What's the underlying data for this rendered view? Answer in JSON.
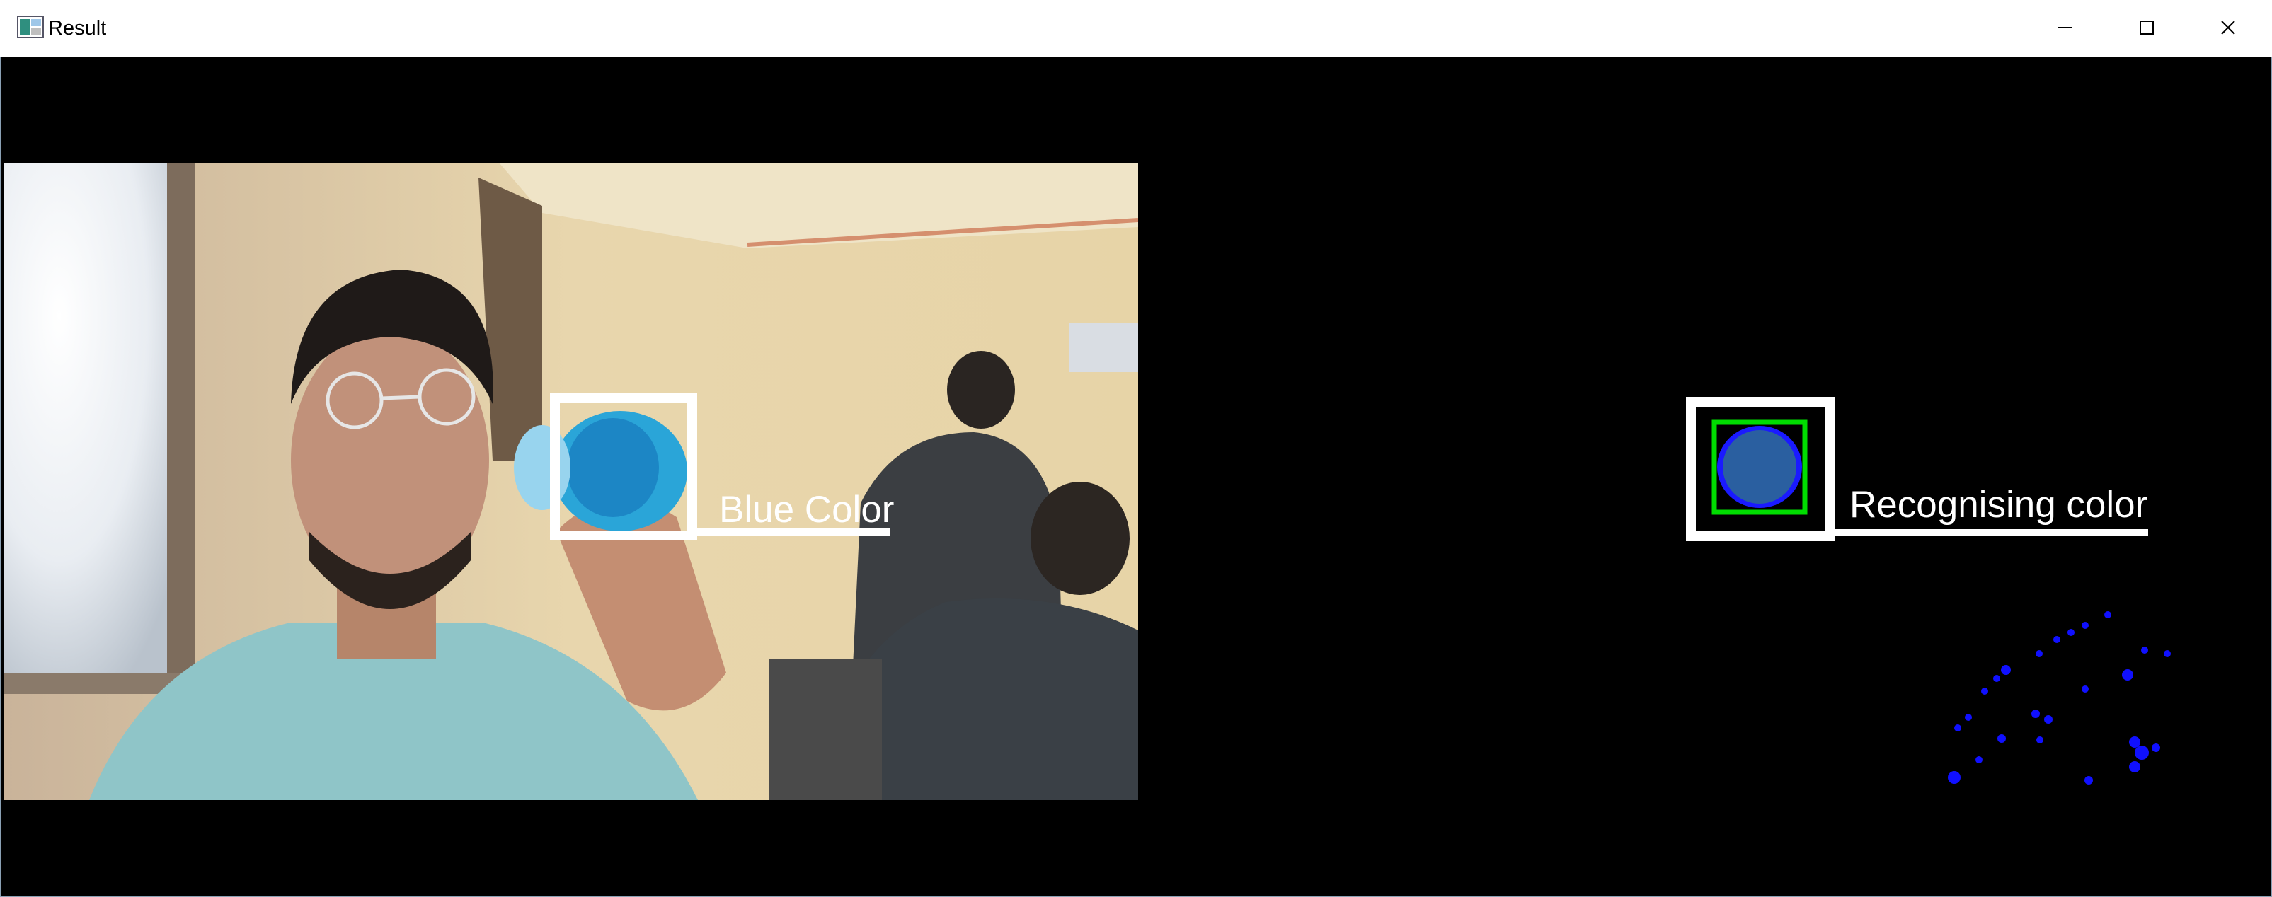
{
  "window": {
    "title": "Result",
    "icon": "opencv-window-icon",
    "controls": [
      "minimize-icon",
      "maximize-icon",
      "close-icon"
    ]
  },
  "left_frame": {
    "detected_label": "Blue Color",
    "box_color": "#ffffff"
  },
  "right_frame": {
    "status_label": "Recognising color",
    "outer_box_color": "#ffffff",
    "inner_box_color": "#00dd00",
    "mask_color": "#1a1aff",
    "dot_color": "#1010ff"
  },
  "colors": {
    "background": "#000000",
    "titlebar": "#ffffff"
  }
}
